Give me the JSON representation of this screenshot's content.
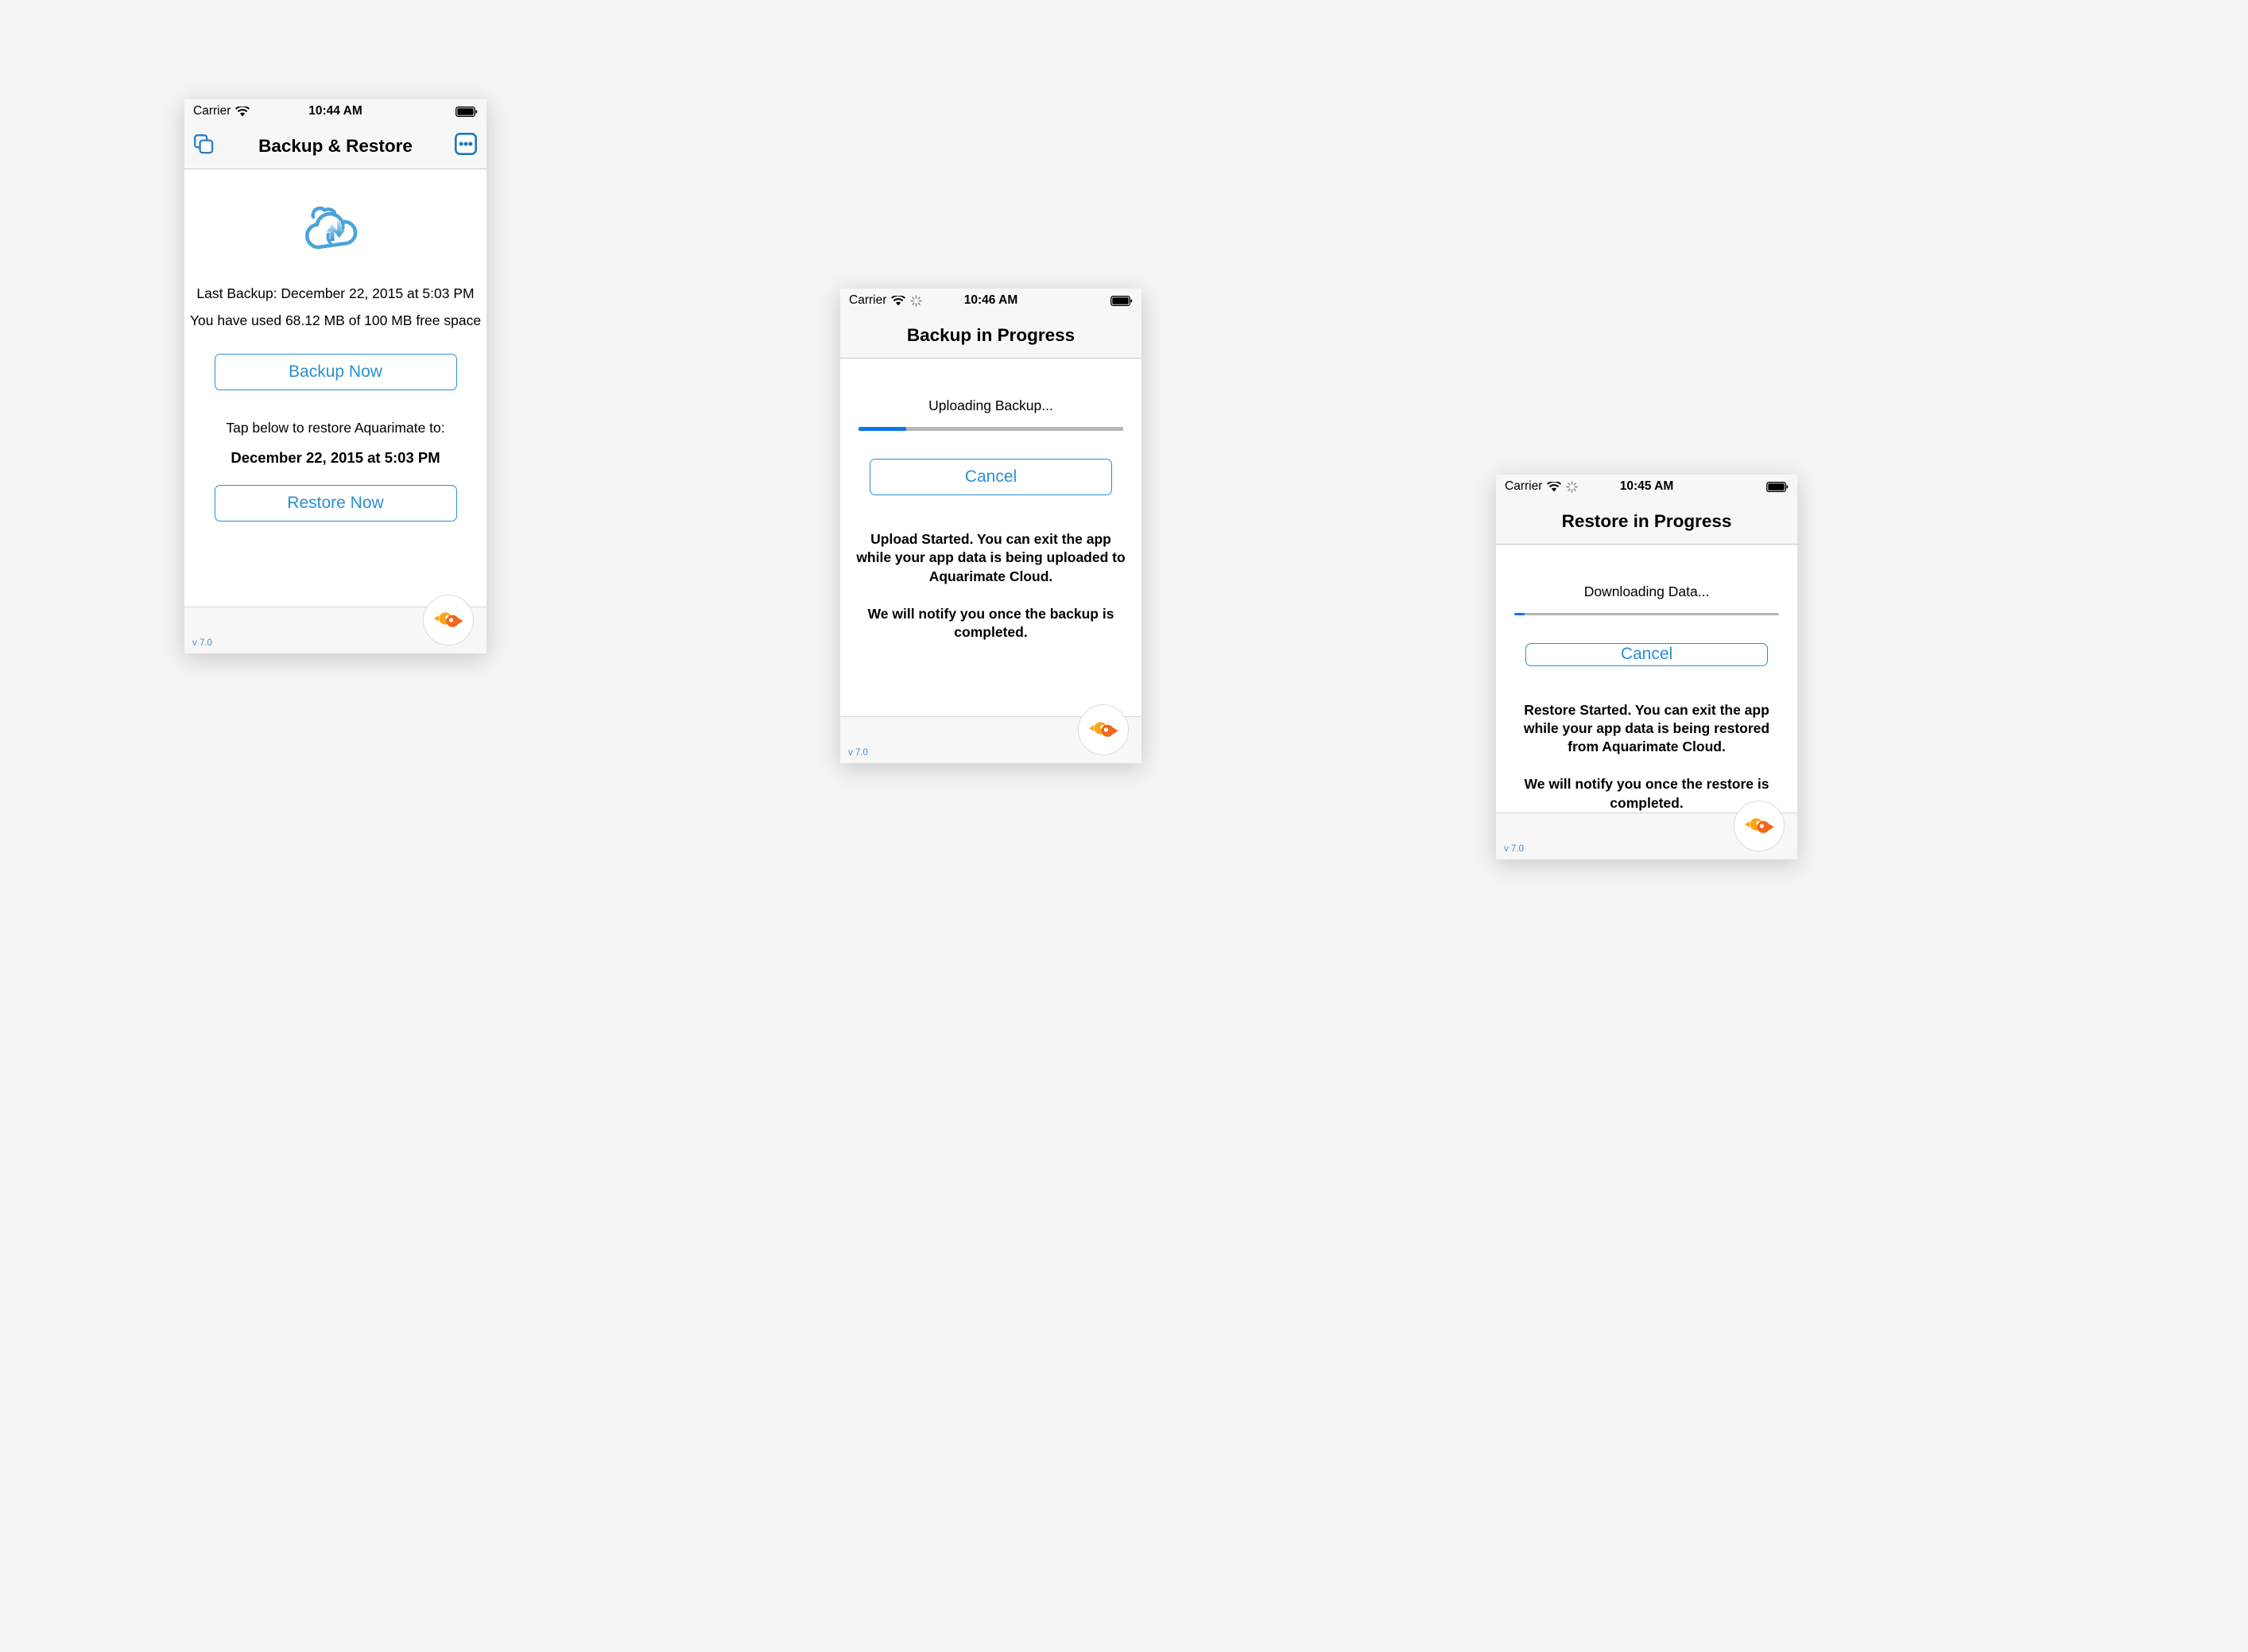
{
  "colors": {
    "accent_blue": "#2a8fd4",
    "progress_blue": "#0a76e8",
    "progress_track": "#b6b6b6",
    "cloud_blue": "#4aa3dc",
    "fish_yellow": "#faa619",
    "fish_orange": "#f4661b",
    "page_background": "#f4f4f4",
    "bar_background": "#f7f7f7"
  },
  "screens": [
    {
      "id": "backup-restore",
      "status_bar": {
        "carrier": "Carrier",
        "wifi_icon": "wifi-icon",
        "activity_icon": null,
        "time": "10:44 AM",
        "battery_icon": "battery-full-icon"
      },
      "nav_bar": {
        "left_icon": "copy-icon",
        "title": "Backup & Restore",
        "right_icon": "more-dots-icon"
      },
      "hero_icon": "cloud-sync-icon",
      "last_backup_line": "Last Backup: December 22, 2015 at 5:03 PM",
      "storage_line": "You have used 68.12 MB of 100 MB free space",
      "backup_button_label": "Backup Now",
      "restore_prompt": "Tap below to restore Aquarimate to:",
      "restore_target": "December 22, 2015 at 5:03 PM",
      "restore_button_label": "Restore Now",
      "footer": {
        "version": "v 7.0",
        "brand_icon": "aquarimate-fish-logo"
      }
    },
    {
      "id": "backup-progress",
      "status_bar": {
        "carrier": "Carrier",
        "wifi_icon": "wifi-icon",
        "activity_icon": "network-activity-spinner-icon",
        "time": "10:46 AM",
        "battery_icon": "battery-full-icon"
      },
      "nav_bar": {
        "left_icon": null,
        "title": "Backup in Progress",
        "right_icon": null
      },
      "progress_label": "Uploading Backup...",
      "progress_percent": 18,
      "cancel_button_label": "Cancel",
      "note_first": "Upload Started. You can exit the app while your app data is being uploaded to Aquarimate Cloud.",
      "note_second": "We will notify you once the backup is completed.",
      "footer": {
        "version": "v 7.0",
        "brand_icon": "aquarimate-fish-logo"
      }
    },
    {
      "id": "restore-progress",
      "status_bar": {
        "carrier": "Carrier",
        "wifi_icon": "wifi-icon",
        "activity_icon": "network-activity-spinner-icon",
        "time": "10:45 AM",
        "battery_icon": "battery-full-icon"
      },
      "nav_bar": {
        "left_icon": null,
        "title": "Restore in Progress",
        "right_icon": null
      },
      "progress_label": "Downloading Data...",
      "progress_percent": 4,
      "cancel_button_label": "Cancel",
      "note_first": "Restore Started. You can exit the app while your app data is being restored from Aquarimate Cloud.",
      "note_second": "We will notify you once the restore is completed.",
      "footer": {
        "version": "v 7.0",
        "brand_icon": "aquarimate-fish-logo"
      }
    }
  ]
}
